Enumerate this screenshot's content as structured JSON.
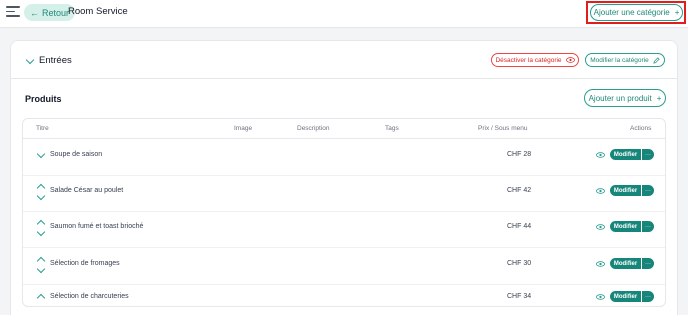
{
  "header": {
    "back_label": "Retour",
    "page_title": "Room Service",
    "add_category_label": "Ajouter une catégorie"
  },
  "section": {
    "title": "Entrées",
    "deactivate_label": "Désactiver la catégorie",
    "edit_label": "Modifier la catégorie"
  },
  "products": {
    "title": "Produits",
    "add_label": "Ajouter un produit",
    "columns": {
      "titre": "Titre",
      "image": "Image",
      "description": "Description",
      "tags": "Tags",
      "price": "Prix / Sous menu",
      "actions": "Actions"
    },
    "rows": [
      {
        "name": "Soupe de saison",
        "price": "CHF 28",
        "action": "Modifier",
        "reorder": "down"
      },
      {
        "name": "Salade César au poulet",
        "price": "CHF 42",
        "action": "Modifier",
        "reorder": "both"
      },
      {
        "name": "Saumon fumé et toast brioché",
        "price": "CHF 44",
        "action": "Modifier",
        "reorder": "both"
      },
      {
        "name": "Sélection de fromages",
        "price": "CHF 30",
        "action": "Modifier",
        "reorder": "both"
      },
      {
        "name": "Sélection de charcuteries",
        "price": "CHF 34",
        "action": "Modifier",
        "reorder": "up"
      }
    ]
  },
  "colors": {
    "accent": "#2a9d8f",
    "button_fill": "#16857a",
    "danger": "#dc2626",
    "highlight": "#e11d1d"
  },
  "icons": {
    "menu": "hamburger-icon",
    "back": "arrow-left-icon",
    "add": "plus-icon",
    "eye": "eye-icon",
    "edit": "pencil-icon",
    "more": "ellipsis-icon"
  }
}
